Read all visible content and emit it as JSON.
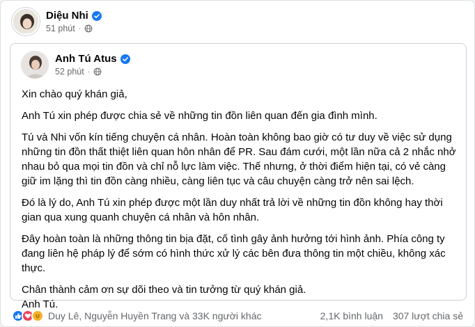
{
  "post": {
    "author": "Diệu Nhi",
    "time": "51 phút",
    "visibility_icon": "globe-icon"
  },
  "shared_post": {
    "author": "Anh Tú Atus",
    "time": "52 phút",
    "visibility_icon": "globe-icon",
    "paragraphs": [
      "Xin chào quý khán giả,",
      "Anh Tú xin phép được chia sẻ về những tin đồn liên quan đến gia đình mình.",
      "Tú và Nhi vốn kín tiếng chuyện cá nhân. Hoàn toàn không bao giờ có tư duy về việc sử dụng những tin đồn thất thiệt liên quan hôn nhân để PR. Sau đám cưới, một lần nữa cả 2 nhắc nhở nhau bỏ qua mọi tin đồn và chỉ nỗ lực làm việc. Thế nhưng, ở thời điểm hiện tại, có vẻ càng giữ im lặng thì tin đồn càng nhiều, càng liên tục và câu chuyện càng trở nên sai lệch.",
      "Đó là lý do, Anh Tú xin phép được một lần duy nhất trả lời về những tin đồn không hay thời gian qua xung quanh chuyện cá nhân và hôn nhân.",
      "Đây hoàn toàn là những thông tin bịa đặt, cố tình gây ảnh hưởng tới hình ảnh. Phía công ty đang liên hệ pháp lý để sớm có hình thức xử lý các bên đưa thông tin một chiều, không xác thực.",
      "Chân thành cảm ơn sự dõi theo và tin tưởng từ quý khán giả.",
      "Anh Tú."
    ]
  },
  "footer": {
    "reactions_text": "Duy Lê, Nguyễn Huyền Trang và 33K người khác",
    "comments": "2,1K bình luận",
    "shares": "307 lượt chia sẻ"
  },
  "colors": {
    "verified": "#1877f2",
    "like": "#1877f2",
    "love": "#f33e58",
    "care": "#f7b125",
    "meta_text": "#65676b"
  }
}
